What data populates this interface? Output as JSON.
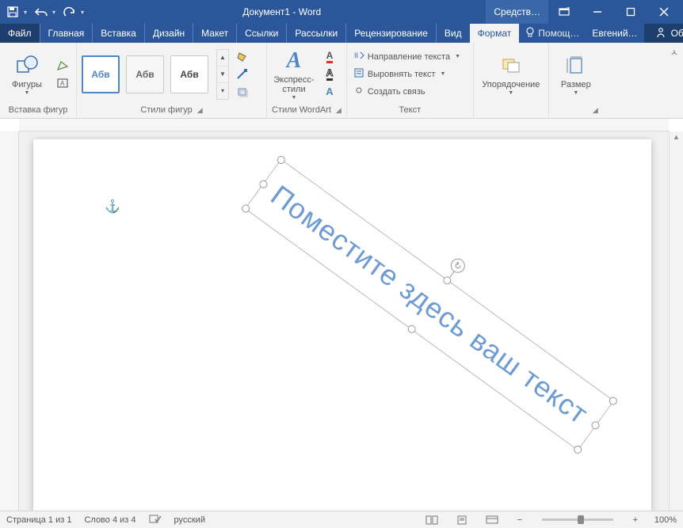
{
  "title": "Документ1 - Word",
  "tools_title": "Средств…",
  "user": "Евгений…",
  "help_placeholder": "Помощ…",
  "share": "Общий доступ",
  "tabs": {
    "file": "Файл",
    "home": "Главная",
    "insert": "Вставка",
    "design": "Дизайн",
    "layout": "Макет",
    "references": "Ссылки",
    "mailings": "Рассылки",
    "review": "Рецензирование",
    "view": "Вид",
    "format": "Формат"
  },
  "ribbon": {
    "shapes": {
      "button": "Фигуры",
      "group": "Вставка фигур"
    },
    "styles": {
      "sample": "Абв",
      "group": "Стили фигур"
    },
    "wordart": {
      "button": "Экспресс-\nстили",
      "group": "Стили WordArt"
    },
    "text": {
      "direction": "Направление текста",
      "align": "Выровнять текст",
      "link": "Создать связь",
      "group": "Текст"
    },
    "arrange": {
      "button": "Упорядочение"
    },
    "size": {
      "button": "Размер"
    }
  },
  "wordart_text": "Поместите здесь ваш текст",
  "status": {
    "page": "Страница 1 из 1",
    "words": "Слово 4 из 4",
    "lang": "русский",
    "zoom": "100%"
  }
}
